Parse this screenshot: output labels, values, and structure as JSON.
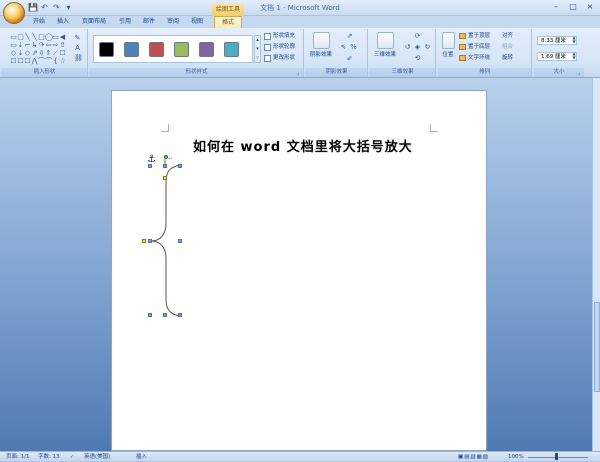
{
  "window": {
    "title": "文档 1 - Microsoft Word",
    "context_tab_title": "绘图工具",
    "controls": {
      "minimize": "–",
      "maximize": "□",
      "close": "×"
    }
  },
  "quick_access": {
    "save": "💾",
    "undo": "↶",
    "redo": "↷",
    "more": "▾"
  },
  "tabs": [
    {
      "label": "开始"
    },
    {
      "label": "插入"
    },
    {
      "label": "页面布局"
    },
    {
      "label": "引用"
    },
    {
      "label": "邮件"
    },
    {
      "label": "审阅"
    },
    {
      "label": "视图"
    },
    {
      "label": "格式",
      "active": true
    }
  ],
  "ribbon": {
    "insert_shapes": {
      "label": "插入形状",
      "glyphs": [
        "▭",
        "▢",
        "╲",
        "╲",
        "□",
        "◯",
        "▭",
        "◀",
        "▭",
        "⇣",
        "⌐",
        "↳",
        "↷",
        "⇦",
        "⇨",
        "⇧",
        "◇",
        "⇣",
        "◇",
        "⇗",
        "⇩",
        "⇑",
        "⟋",
        "☐",
        "☐",
        "☐",
        "☐",
        "⋀",
        "⌒",
        "⌒",
        "{",
        "☆"
      ]
    },
    "shape_styles": {
      "label": "形状样式",
      "swatches": [
        "#000000",
        "#4f81bd",
        "#c0504d",
        "#9bbb59",
        "#8064a2",
        "#4bacc6"
      ],
      "fill": "形状填充",
      "outline": "形状轮廓",
      "change": "更改形状"
    },
    "shadow": {
      "label": "阴影效果",
      "button": "阴影效果"
    },
    "threed": {
      "label": "三维效果",
      "button": "三维效果"
    },
    "arrange": {
      "label": "排列",
      "position": "位置",
      "bring_front": "置于顶层",
      "send_back": "置于底层",
      "wrap": "文字环绕",
      "align": "对齐",
      "group": "组合",
      "rotate": "旋转"
    },
    "size": {
      "label": "大小",
      "height": "8.33 厘米",
      "width": "1.69 厘米"
    }
  },
  "document": {
    "title": "如何在 word 文档里将大括号放大"
  },
  "status": {
    "page": "页面: 1/1",
    "words": "字数: 13",
    "language": "英语(美国)",
    "mode": "插入",
    "zoom": "100%"
  }
}
